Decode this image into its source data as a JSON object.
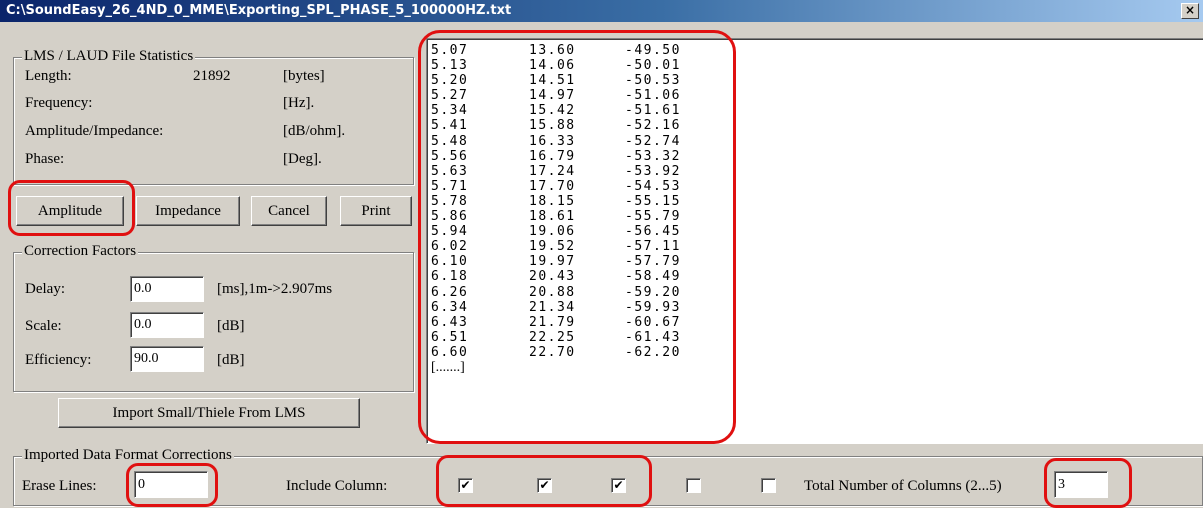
{
  "window": {
    "title": "C:\\SoundEasy_26_4ND_0_MME\\Exporting_SPL_PHASE_5_100000HZ.txt",
    "close_label": "×"
  },
  "stats": {
    "legend": "LMS / LAUD File Statistics",
    "length_label": "Length:",
    "length_value": "21892",
    "length_unit": "[bytes]",
    "frequency_label": "Frequency:",
    "frequency_unit": "[Hz].",
    "amplitude_label": "Amplitude/Impedance:",
    "amplitude_unit": "[dB/ohm].",
    "phase_label": "Phase:",
    "phase_unit": "[Deg]."
  },
  "buttons": {
    "amplitude": "Amplitude",
    "impedance": "Impedance",
    "cancel": "Cancel",
    "print": "Print",
    "import": "Import Small/Thiele From LMS"
  },
  "correction": {
    "legend": "Correction Factors",
    "delay_label": "Delay:",
    "delay_value": "0.0",
    "delay_unit": "[ms],1m->2.907ms",
    "scale_label": "Scale:",
    "scale_value": "0.0",
    "scale_unit": "[dB]",
    "efficiency_label": "Efficiency:",
    "efficiency_value": "90.0",
    "efficiency_unit": "[dB]"
  },
  "data_rows": [
    [
      "5.07",
      "13.60",
      "-49.50"
    ],
    [
      "5.13",
      "14.06",
      "-50.01"
    ],
    [
      "5.20",
      "14.51",
      "-50.53"
    ],
    [
      "5.27",
      "14.97",
      "-51.06"
    ],
    [
      "5.34",
      "15.42",
      "-51.61"
    ],
    [
      "5.41",
      "15.88",
      "-52.16"
    ],
    [
      "5.48",
      "16.33",
      "-52.74"
    ],
    [
      "5.56",
      "16.79",
      "-53.32"
    ],
    [
      "5.63",
      "17.24",
      "-53.92"
    ],
    [
      "5.71",
      "17.70",
      "-54.53"
    ],
    [
      "5.78",
      "18.15",
      "-55.15"
    ],
    [
      "5.86",
      "18.61",
      "-55.79"
    ],
    [
      "5.94",
      "19.06",
      "-56.45"
    ],
    [
      "6.02",
      "19.52",
      "-57.11"
    ],
    [
      "6.10",
      "19.97",
      "-57.79"
    ],
    [
      "6.18",
      "20.43",
      "-58.49"
    ],
    [
      "6.26",
      "20.88",
      "-59.20"
    ],
    [
      "6.34",
      "21.34",
      "-59.93"
    ],
    [
      "6.43",
      "21.79",
      "-60.67"
    ],
    [
      "6.51",
      "22.25",
      "-61.43"
    ],
    [
      "6.60",
      "22.70",
      "-62.20"
    ]
  ],
  "data_ellipsis": "[.......]",
  "format": {
    "legend": "Imported Data Format Corrections",
    "erase_label": "Erase Lines:",
    "erase_value": "0",
    "include_label": "Include Column:",
    "columns": [
      {
        "checked": true
      },
      {
        "checked": true
      },
      {
        "checked": true
      },
      {
        "checked": false
      },
      {
        "checked": false
      }
    ],
    "total_label": "Total Number of Columns (2...5)",
    "total_value": "3"
  },
  "colors": {
    "annotation": "#e01010",
    "titlebar": "#0a246a",
    "face": "#d4d0c8"
  }
}
